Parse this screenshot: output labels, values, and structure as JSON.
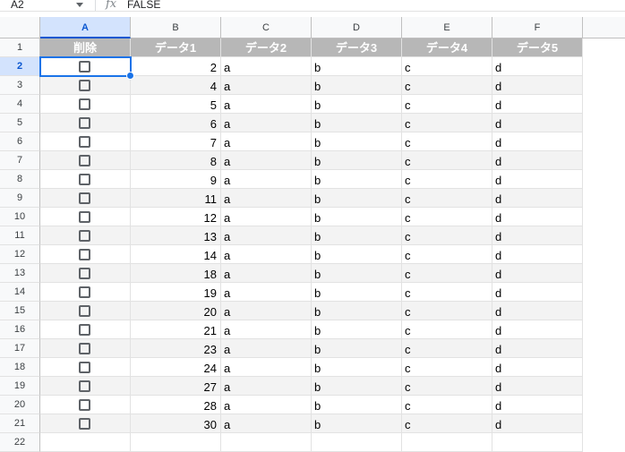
{
  "formula_bar": {
    "name_box": "A2",
    "fx_icon": "fx",
    "formula": "FALSE"
  },
  "columns": [
    "A",
    "B",
    "C",
    "D",
    "E",
    "F"
  ],
  "selected_column": "A",
  "selected_row": "2",
  "header_row": {
    "row_number": "1",
    "cells": [
      "削除",
      "データ1",
      "データ2",
      "データ3",
      "データ4",
      "データ5"
    ]
  },
  "rows": [
    {
      "row_number": "2",
      "checked": false,
      "data1": "2",
      "data2": "a",
      "data3": "b",
      "data4": "c",
      "data5": "d"
    },
    {
      "row_number": "3",
      "checked": false,
      "data1": "4",
      "data2": "a",
      "data3": "b",
      "data4": "c",
      "data5": "d"
    },
    {
      "row_number": "4",
      "checked": false,
      "data1": "5",
      "data2": "a",
      "data3": "b",
      "data4": "c",
      "data5": "d"
    },
    {
      "row_number": "5",
      "checked": false,
      "data1": "6",
      "data2": "a",
      "data3": "b",
      "data4": "c",
      "data5": "d"
    },
    {
      "row_number": "6",
      "checked": false,
      "data1": "7",
      "data2": "a",
      "data3": "b",
      "data4": "c",
      "data5": "d"
    },
    {
      "row_number": "7",
      "checked": false,
      "data1": "8",
      "data2": "a",
      "data3": "b",
      "data4": "c",
      "data5": "d"
    },
    {
      "row_number": "8",
      "checked": false,
      "data1": "9",
      "data2": "a",
      "data3": "b",
      "data4": "c",
      "data5": "d"
    },
    {
      "row_number": "9",
      "checked": false,
      "data1": "11",
      "data2": "a",
      "data3": "b",
      "data4": "c",
      "data5": "d"
    },
    {
      "row_number": "10",
      "checked": false,
      "data1": "12",
      "data2": "a",
      "data3": "b",
      "data4": "c",
      "data5": "d"
    },
    {
      "row_number": "11",
      "checked": false,
      "data1": "13",
      "data2": "a",
      "data3": "b",
      "data4": "c",
      "data5": "d"
    },
    {
      "row_number": "12",
      "checked": false,
      "data1": "14",
      "data2": "a",
      "data3": "b",
      "data4": "c",
      "data5": "d"
    },
    {
      "row_number": "13",
      "checked": false,
      "data1": "18",
      "data2": "a",
      "data3": "b",
      "data4": "c",
      "data5": "d"
    },
    {
      "row_number": "14",
      "checked": false,
      "data1": "19",
      "data2": "a",
      "data3": "b",
      "data4": "c",
      "data5": "d"
    },
    {
      "row_number": "15",
      "checked": false,
      "data1": "20",
      "data2": "a",
      "data3": "b",
      "data4": "c",
      "data5": "d"
    },
    {
      "row_number": "16",
      "checked": false,
      "data1": "21",
      "data2": "a",
      "data3": "b",
      "data4": "c",
      "data5": "d"
    },
    {
      "row_number": "17",
      "checked": false,
      "data1": "23",
      "data2": "a",
      "data3": "b",
      "data4": "c",
      "data5": "d"
    },
    {
      "row_number": "18",
      "checked": false,
      "data1": "24",
      "data2": "a",
      "data3": "b",
      "data4": "c",
      "data5": "d"
    },
    {
      "row_number": "19",
      "checked": false,
      "data1": "27",
      "data2": "a",
      "data3": "b",
      "data4": "c",
      "data5": "d"
    },
    {
      "row_number": "20",
      "checked": false,
      "data1": "28",
      "data2": "a",
      "data3": "b",
      "data4": "c",
      "data5": "d"
    },
    {
      "row_number": "21",
      "checked": false,
      "data1": "30",
      "data2": "a",
      "data3": "b",
      "data4": "c",
      "data5": "d"
    }
  ],
  "empty_rows": [
    "22"
  ],
  "colors": {
    "header_fill": "#b7b7b7",
    "banding_fill": "#f3f3f3",
    "selection": "#1a73e8"
  }
}
